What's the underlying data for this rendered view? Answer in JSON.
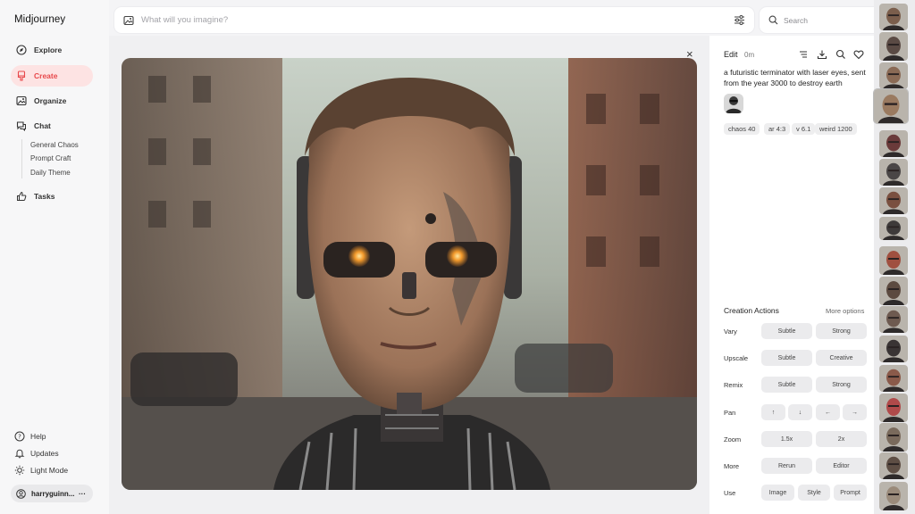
{
  "app": {
    "logo": "Midjourney"
  },
  "sidebar": {
    "items": [
      {
        "label": "Explore",
        "icon": "compass-icon"
      },
      {
        "label": "Create",
        "icon": "brush-icon",
        "active": true
      },
      {
        "label": "Organize",
        "icon": "image-icon"
      },
      {
        "label": "Chat",
        "icon": "chat-icon"
      },
      {
        "label": "Tasks",
        "icon": "thumbs-up-icon"
      }
    ],
    "chat_rooms": [
      "General Chaos",
      "Prompt Craft",
      "Daily Theme"
    ],
    "bottom": [
      {
        "label": "Help",
        "icon": "help-icon"
      },
      {
        "label": "Updates",
        "icon": "bell-icon"
      },
      {
        "label": "Light Mode",
        "icon": "sun-icon"
      }
    ],
    "user": {
      "name": "harryguinn...",
      "menu": "···"
    }
  },
  "prompt_bar": {
    "placeholder": "What will you imagine?"
  },
  "search": {
    "placeholder": "Search"
  },
  "viewer": {
    "close": "×"
  },
  "details": {
    "edit": "Edit",
    "age": "0m",
    "prompt": "a futuristic terminator with laser eyes, sent from the year 3000 to destroy earth",
    "params": [
      "chaos 40",
      "ar 4:3",
      "v 6.1",
      "weird 1200"
    ],
    "tools": [
      "filter-lines-icon",
      "download-icon",
      "search-icon",
      "heart-icon"
    ]
  },
  "creation_actions": {
    "title": "Creation Actions",
    "more": "More options",
    "rows": [
      {
        "label": "Vary",
        "buttons": [
          "Subtle",
          "Strong"
        ]
      },
      {
        "label": "Upscale",
        "buttons": [
          "Subtle",
          "Creative"
        ]
      },
      {
        "label": "Remix",
        "buttons": [
          "Subtle",
          "Strong"
        ]
      },
      {
        "label": "Pan",
        "buttons": [
          "↑",
          "↓",
          "←",
          "→"
        ]
      },
      {
        "label": "Zoom",
        "buttons": [
          "1.5x",
          "2x"
        ]
      },
      {
        "label": "More",
        "buttons": [
          "Rerun",
          "Editor"
        ]
      },
      {
        "label": "Use",
        "buttons": [
          "Image",
          "Style",
          "Prompt"
        ]
      }
    ]
  },
  "colors": {
    "accent": "#e8484b",
    "accent_bg": "#fde3e3",
    "panel_bg": "#ffffff",
    "page_bg": "#f4f4f6"
  }
}
